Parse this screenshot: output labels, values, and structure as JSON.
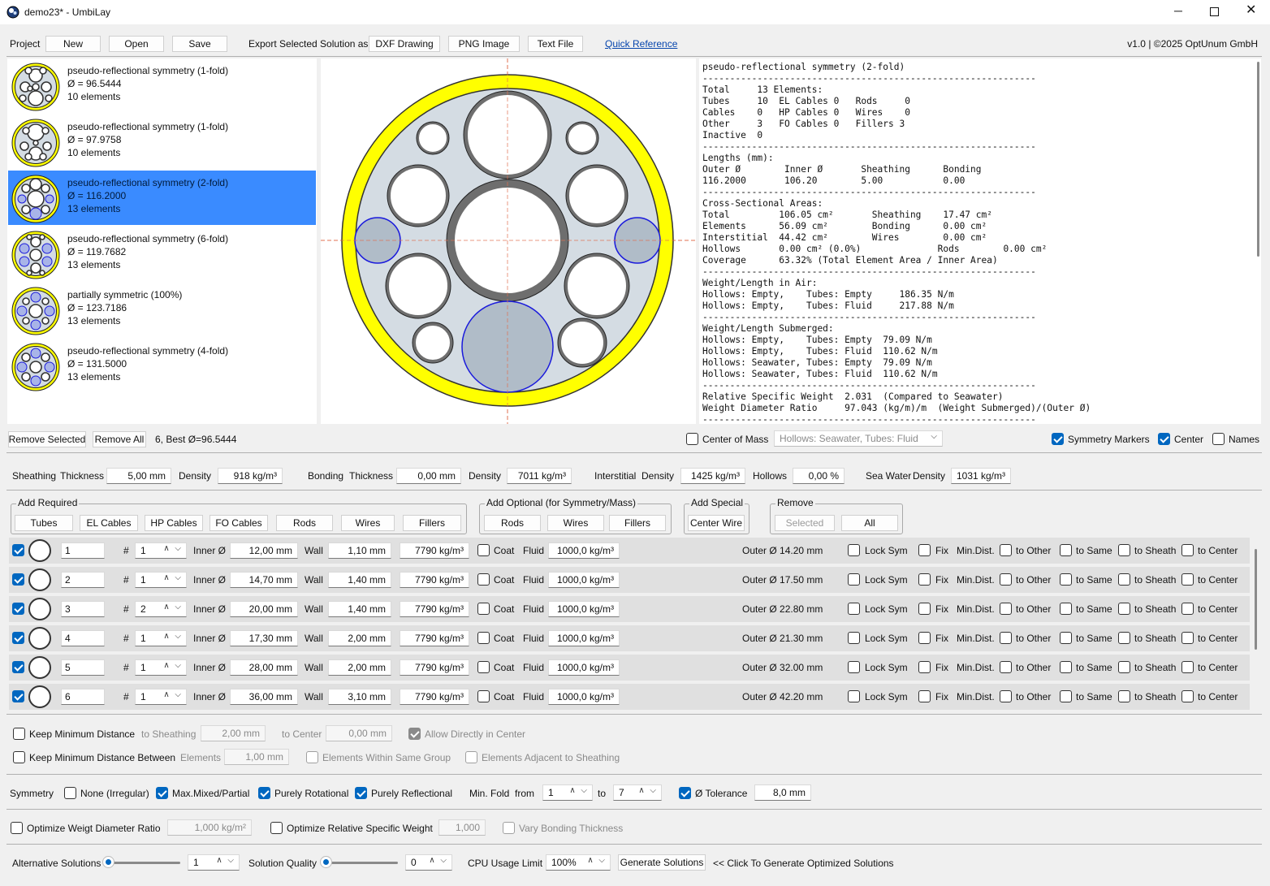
{
  "window": {
    "title": "demo23* - UmbiLay"
  },
  "menubar": {
    "project_label": "Project",
    "new": "New",
    "open": "Open",
    "save": "Save",
    "export_label": "Export Selected Solution as",
    "dxf": "DXF Drawing",
    "png": "PNG Image",
    "text": "Text File",
    "quick_reference": "Quick Reference",
    "version": "v1.0 | ©2025 OptUnum GmbH"
  },
  "solutions": [
    {
      "name": "pseudo-reflectional symmetry (1-fold)",
      "diameter": "Ø = 96.5444",
      "elements": "10 elements",
      "selected": false
    },
    {
      "name": "pseudo-reflectional symmetry (1-fold)",
      "diameter": "Ø = 97.9758",
      "elements": "10 elements",
      "selected": false
    },
    {
      "name": "pseudo-reflectional symmetry (2-fold)",
      "diameter": "Ø = 116.2000",
      "elements": "13 elements",
      "selected": true
    },
    {
      "name": "pseudo-reflectional symmetry (6-fold)",
      "diameter": "Ø = 119.7682",
      "elements": "13 elements",
      "selected": false
    },
    {
      "name": "partially symmetric (100%)",
      "diameter": "Ø = 123.7186",
      "elements": "13 elements",
      "selected": false
    },
    {
      "name": "pseudo-reflectional symmetry (4-fold)",
      "diameter": "Ø = 131.5000",
      "elements": "13 elements",
      "selected": false
    }
  ],
  "report": {
    "lines": [
      "pseudo-reflectional symmetry (2-fold)",
      "-------------------------------------------------------------",
      "Total     13 Elements:",
      "Tubes     10  EL Cables 0   Rods     0",
      "Cables    0   HP Cables 0   Wires    0",
      "Other     3   FO Cables 0   Fillers 3",
      "Inactive  0",
      "-------------------------------------------------------------",
      "Lengths (mm):",
      "Outer Ø        Inner Ø       Sheathing      Bonding",
      "116.2000       106.20        5.00           0.00",
      "-------------------------------------------------------------",
      "Cross-Sectional Areas:",
      "Total         106.05 cm²       Sheathing    17.47 cm²",
      "Elements      56.09 cm²        Bonding      0.00 cm²",
      "Interstitial  44.42 cm²        Wires        0.00 cm²",
      "Hollows       0.00 cm² (0.0%)              Rods        0.00 cm²",
      "Coverage      63.32% (Total Element Area / Inner Area)",
      "-------------------------------------------------------------",
      "Weight/Length in Air:",
      "Hollows: Empty,    Tubes: Empty     186.35 N/m",
      "Hollows: Empty,    Tubes: Fluid     217.88 N/m",
      "-------------------------------------------------------------",
      "Weight/Length Submerged:",
      "Hollows: Empty,    Tubes: Empty  79.09 N/m",
      "Hollows: Empty,    Tubes: Fluid  110.62 N/m",
      "Hollows: Seawater, Tubes: Empty  79.09 N/m",
      "Hollows: Seawater, Tubes: Fluid  110.62 N/m",
      "-------------------------------------------------------------",
      "Relative Specific Weight  2.031  (Compared to Seawater)",
      "Weight Diameter Ratio     97.043 (kg/m)/m  (Weight Submerged)/(Outer Ø)",
      "-------------------------------------------------------------"
    ]
  },
  "listbar": {
    "remove_selected": "Remove Selected",
    "remove_all": "Remove All",
    "summary": "6, Best Ø=96.5444",
    "center_of_mass": "Center of Mass",
    "mass_mode": "Hollows: Seawater, Tubes: Fluid",
    "symmetry_markers": "Symmetry Markers",
    "center": "Center",
    "names": "Names"
  },
  "materials": {
    "sheathing": "Sheathing",
    "thickness": "Thickness",
    "sheathing_thickness": "5,00 mm",
    "density": "Density",
    "sheathing_density": "918 kg/m³",
    "bonding": "Bonding",
    "bonding_thickness": "0,00 mm",
    "bonding_density": "7011 kg/m³",
    "interstitial": "Interstitial",
    "interstitial_density": "1425 kg/m³",
    "hollows": "Hollows",
    "hollows_value": "0,00 %",
    "sea_water": "Sea Water",
    "sea_water_density": "1031 kg/m³"
  },
  "add_required": {
    "label": "Add Required",
    "buttons": [
      "Tubes",
      "EL Cables",
      "HP Cables",
      "FO Cables",
      "Rods",
      "Wires",
      "Fillers"
    ]
  },
  "add_optional": {
    "label": "Add Optional (for Symmetry/Mass)",
    "buttons": [
      "Rods",
      "Wires",
      "Fillers"
    ]
  },
  "add_special": {
    "label": "Add Special",
    "center_wire": "Center Wire"
  },
  "remove_group": {
    "label": "Remove",
    "selected": "Selected",
    "all": "All"
  },
  "row_labels": {
    "hash": "#",
    "inner": "Inner Ø",
    "wall": "Wall",
    "coat": "Coat",
    "fluid": "Fluid",
    "lock_sym": "Lock Sym",
    "fix": "Fix",
    "min_dist": "Min.Dist.",
    "to_other": "to Other",
    "to_same": "to Same",
    "to_sheath": "to Sheath",
    "to_center": "to Center"
  },
  "elements": [
    {
      "name": "1",
      "count": "1",
      "inner": "12,00 mm",
      "wall": "1,10 mm",
      "density": "7790 kg/m³",
      "fluid": "1000,0 kg/m³",
      "outer": "Outer Ø 14.20 mm"
    },
    {
      "name": "2",
      "count": "1",
      "inner": "14,70 mm",
      "wall": "1,40 mm",
      "density": "7790 kg/m³",
      "fluid": "1000,0 kg/m³",
      "outer": "Outer Ø 17.50 mm"
    },
    {
      "name": "3",
      "count": "2",
      "inner": "20,00 mm",
      "wall": "1,40 mm",
      "density": "7790 kg/m³",
      "fluid": "1000,0 kg/m³",
      "outer": "Outer Ø 22.80 mm"
    },
    {
      "name": "4",
      "count": "1",
      "inner": "17,30 mm",
      "wall": "2,00 mm",
      "density": "7790 kg/m³",
      "fluid": "1000,0 kg/m³",
      "outer": "Outer Ø 21.30 mm"
    },
    {
      "name": "5",
      "count": "1",
      "inner": "28,00 mm",
      "wall": "2,00 mm",
      "density": "7790 kg/m³",
      "fluid": "1000,0 kg/m³",
      "outer": "Outer Ø 32.00 mm"
    },
    {
      "name": "6",
      "count": "1",
      "inner": "36,00 mm",
      "wall": "3,10 mm",
      "density": "7790 kg/m³",
      "fluid": "1000,0 kg/m³",
      "outer": "Outer Ø 42.20 mm"
    }
  ],
  "distance": {
    "keep_min": "Keep Minimum Distance",
    "to_sheathing": "to Sheathing",
    "to_sheathing_value": "2,00 mm",
    "to_center": "to Center",
    "to_center_value": "0,00 mm",
    "allow_center": "Allow Directly in Center",
    "keep_between": "Keep Minimum Distance Between",
    "elements": "Elements",
    "elements_value": "1,00 mm",
    "within_group": "Elements Within Same Group",
    "adjacent": "Elements Adjacent to Sheathing"
  },
  "symmetry": {
    "label": "Symmetry",
    "none": "None (Irregular)",
    "mixed": "Max.Mixed/Partial",
    "rotational": "Purely Rotational",
    "reflectional": "Purely Reflectional",
    "min_fold": "Min. Fold",
    "from": "from",
    "from_value": "1",
    "to": "to",
    "to_value": "7",
    "tolerance": "Ø Tolerance",
    "tolerance_value": "8,0 mm"
  },
  "optimize": {
    "weight_ratio": "Optimize Weigt Diameter Ratio",
    "weight_ratio_value": "1,000 kg/m²",
    "rel_weight": "Optimize Relative Specific Weight",
    "rel_weight_value": "1,000",
    "vary_bonding": "Vary Bonding Thickness"
  },
  "bottom": {
    "alt_solutions": "Alternative Solutions",
    "alt_value": "1",
    "quality": "Solution Quality",
    "quality_value": "0",
    "cpu": "CPU Usage Limit",
    "cpu_value": "100%",
    "generate": "Generate Solutions",
    "hint": "<< Click To Generate Optimized Solutions"
  },
  "colors": {
    "sheath": "#ffff00",
    "inner_fill": "#d4dce3",
    "tube_wall": "#6e6e6e",
    "filler": "#b0bcc8",
    "filler_stroke": "#1a1adc",
    "selection": "#3a8bff",
    "check": "#0067c0"
  }
}
